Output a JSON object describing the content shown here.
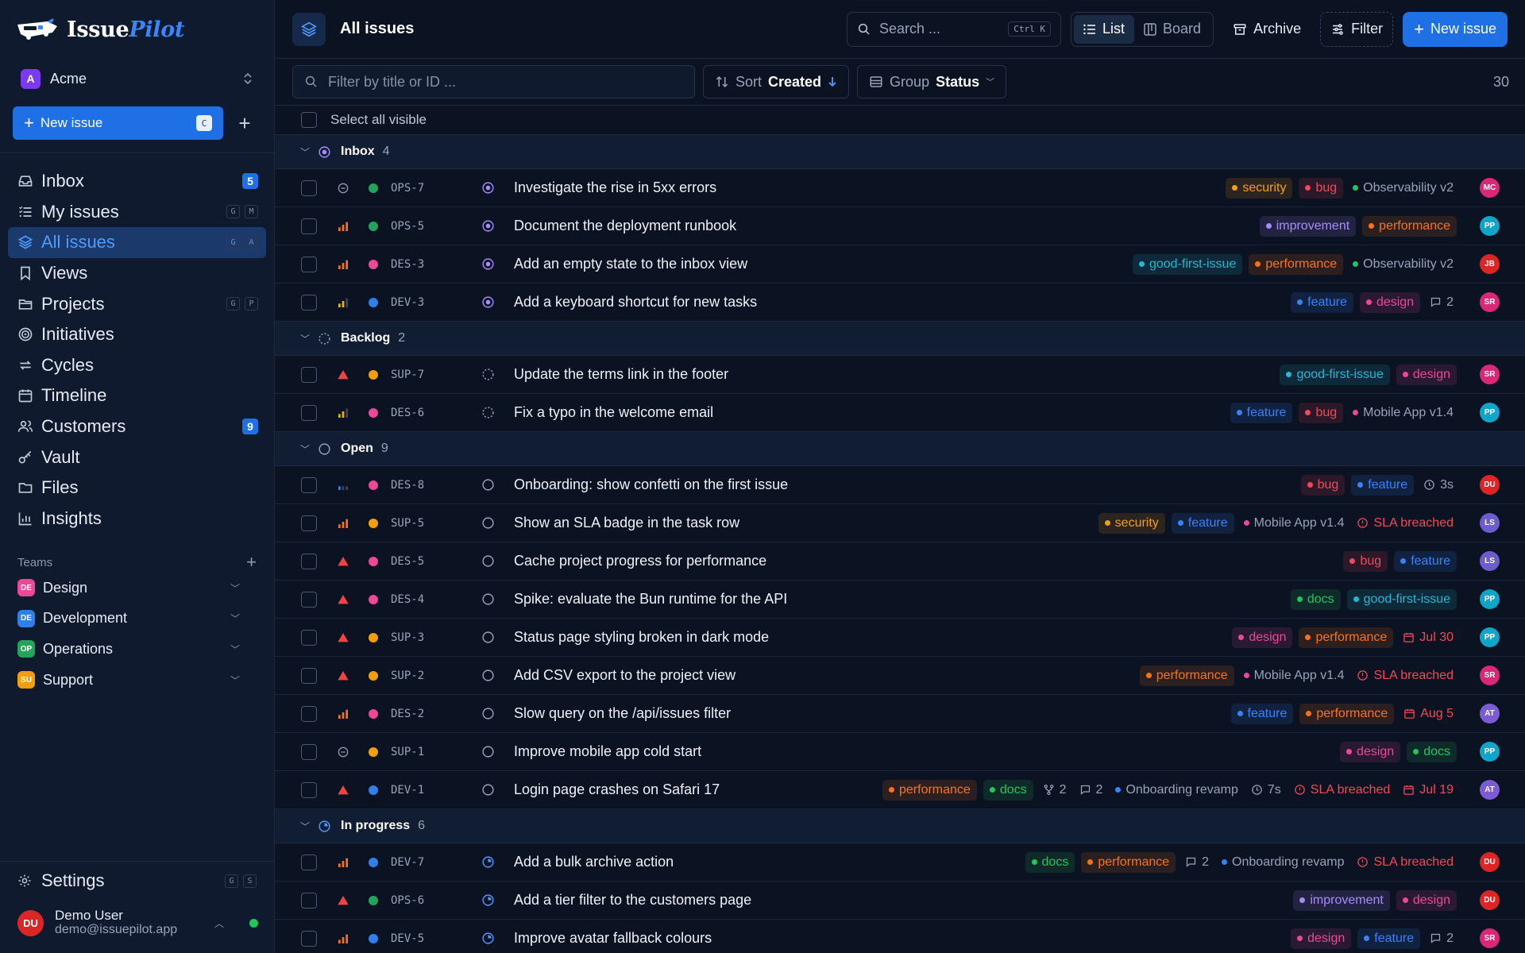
{
  "brand": {
    "name_a": "Issue",
    "name_b": "Pilot"
  },
  "workspace": {
    "initial": "A",
    "name": "Acme"
  },
  "sidebar": {
    "new_issue": {
      "label": "New issue",
      "key": "C"
    },
    "nav": [
      {
        "name": "inbox",
        "label": "Inbox",
        "icon": "inbox-icon",
        "badge": "5",
        "keys": []
      },
      {
        "name": "my-issues",
        "label": "My issues",
        "icon": "list-icon",
        "badge": "",
        "keys": [
          "G",
          "M"
        ]
      },
      {
        "name": "all-issues",
        "label": "All issues",
        "icon": "layers-icon",
        "badge": "",
        "keys": [
          "G",
          "A"
        ],
        "active": true
      },
      {
        "name": "views",
        "label": "Views",
        "icon": "bookmark-icon",
        "badge": "",
        "keys": []
      },
      {
        "name": "projects",
        "label": "Projects",
        "icon": "folder-icon",
        "badge": "",
        "keys": [
          "G",
          "P"
        ]
      },
      {
        "name": "initiatives",
        "label": "Initiatives",
        "icon": "target-icon",
        "badge": "",
        "keys": []
      },
      {
        "name": "cycles",
        "label": "Cycles",
        "icon": "cycle-icon",
        "badge": "",
        "keys": []
      },
      {
        "name": "timeline",
        "label": "Timeline",
        "icon": "calendar-icon",
        "badge": "",
        "keys": []
      },
      {
        "name": "customers",
        "label": "Customers",
        "icon": "users-icon",
        "badge": "9",
        "keys": []
      },
      {
        "name": "vault",
        "label": "Vault",
        "icon": "key-icon",
        "badge": "",
        "keys": []
      },
      {
        "name": "files",
        "label": "Files",
        "icon": "files-icon",
        "badge": "",
        "keys": []
      },
      {
        "name": "insights",
        "label": "Insights",
        "icon": "chart-icon",
        "badge": "",
        "keys": []
      }
    ],
    "teams_label": "Teams",
    "teams": [
      {
        "initials": "DE",
        "name": "Design",
        "color": "#ec4899"
      },
      {
        "initials": "DE",
        "name": "Development",
        "color": "#2f80ed"
      },
      {
        "initials": "OP",
        "name": "Operations",
        "color": "#22a559"
      },
      {
        "initials": "SU",
        "name": "Support",
        "color": "#f59e0b"
      }
    ],
    "settings": {
      "label": "Settings",
      "keys": [
        "G",
        "S"
      ]
    },
    "user": {
      "initials": "DU",
      "name": "Demo User",
      "email": "demo@issuepilot.app"
    }
  },
  "header": {
    "title": "All issues",
    "search_placeholder": "Search ...",
    "search_key": "Ctrl K",
    "view_list": "List",
    "view_board": "Board",
    "archive": "Archive",
    "filter": "Filter",
    "new_issue": "New issue"
  },
  "filters": {
    "title_placeholder": "Filter by title or ID ...",
    "sort_label": "Sort",
    "sort_value": "Created",
    "group_label": "Group",
    "group_value": "Status",
    "count": "30"
  },
  "select_all": "Select all visible",
  "colors": {
    "security": "#f59e0b",
    "bug": "#f04a58",
    "improvement": "#a78bfa",
    "performance": "#f97316",
    "good-first-issue": "#22b8cf",
    "feature": "#3b82f6",
    "design": "#ec4899",
    "docs": "#22c55e",
    "team_design": "#ec4899",
    "team_dev": "#2f80ed",
    "team_ops": "#22a559",
    "team_sup": "#f59e0b"
  },
  "groups": [
    {
      "name": "Inbox",
      "count": "4",
      "status": "inbox",
      "rows": [
        {
          "id": "OPS-7",
          "title": "Investigate the rise in 5xx errors",
          "prio": "none",
          "team": "ops",
          "meta": [
            {
              "t": "tag",
              "v": "security"
            },
            {
              "t": "tag",
              "v": "bug"
            },
            {
              "t": "proj",
              "v": "Observability v2",
              "c": "#22c55e"
            }
          ],
          "av": {
            "i": "MC",
            "c": "#db2777"
          }
        },
        {
          "id": "OPS-5",
          "title": "Document the deployment runbook",
          "prio": "high",
          "team": "ops",
          "meta": [
            {
              "t": "tag",
              "v": "improvement"
            },
            {
              "t": "tag",
              "v": "performance"
            }
          ],
          "av": {
            "i": "PP",
            "c": "#0ea5c9"
          }
        },
        {
          "id": "DES-3",
          "title": "Add an empty state to the inbox view",
          "prio": "high",
          "team": "design",
          "meta": [
            {
              "t": "tag",
              "v": "good-first-issue"
            },
            {
              "t": "tag",
              "v": "performance"
            },
            {
              "t": "proj",
              "v": "Observability v2",
              "c": "#22c55e"
            }
          ],
          "av": {
            "i": "JB",
            "c": "#dc2626"
          }
        },
        {
          "id": "DEV-3",
          "title": "Add a keyboard shortcut for new tasks",
          "prio": "medium",
          "team": "dev",
          "meta": [
            {
              "t": "tag",
              "v": "feature"
            },
            {
              "t": "tag",
              "v": "design"
            },
            {
              "t": "comments",
              "v": "2"
            }
          ],
          "av": {
            "i": "SR",
            "c": "#db2777"
          }
        }
      ]
    },
    {
      "name": "Backlog",
      "count": "2",
      "status": "backlog",
      "rows": [
        {
          "id": "SUP-7",
          "title": "Update the terms link in the footer",
          "prio": "urgent",
          "team": "sup",
          "meta": [
            {
              "t": "tag",
              "v": "good-first-issue"
            },
            {
              "t": "tag",
              "v": "design"
            }
          ],
          "av": {
            "i": "SR",
            "c": "#db2777"
          }
        },
        {
          "id": "DES-6",
          "title": "Fix a typo in the welcome email",
          "prio": "medium",
          "team": "design",
          "meta": [
            {
              "t": "tag",
              "v": "feature"
            },
            {
              "t": "tag",
              "v": "bug"
            },
            {
              "t": "proj",
              "v": "Mobile App v1.4",
              "c": "#ec4899"
            }
          ],
          "av": {
            "i": "PP",
            "c": "#0ea5c9"
          }
        }
      ]
    },
    {
      "name": "Open",
      "count": "9",
      "status": "open",
      "rows": [
        {
          "id": "DES-8",
          "title": "Onboarding: show confetti on the first issue",
          "prio": "low",
          "team": "design",
          "meta": [
            {
              "t": "tag",
              "v": "bug"
            },
            {
              "t": "tag",
              "v": "feature"
            },
            {
              "t": "time",
              "v": "3s"
            }
          ],
          "av": {
            "i": "DU",
            "c": "#dc2626"
          }
        },
        {
          "id": "SUP-5",
          "title": "Show an SLA badge in the task row",
          "prio": "high",
          "team": "sup",
          "meta": [
            {
              "t": "tag",
              "v": "security"
            },
            {
              "t": "tag",
              "v": "feature"
            },
            {
              "t": "proj",
              "v": "Mobile App v1.4",
              "c": "#ec4899"
            },
            {
              "t": "sla",
              "v": "SLA breached"
            }
          ],
          "av": {
            "i": "LS",
            "c": "#6d5bd0"
          }
        },
        {
          "id": "DES-5",
          "title": "Cache project progress for performance",
          "prio": "urgent",
          "team": "design",
          "meta": [
            {
              "t": "tag",
              "v": "bug"
            },
            {
              "t": "tag",
              "v": "feature"
            }
          ],
          "av": {
            "i": "LS",
            "c": "#6d5bd0"
          }
        },
        {
          "id": "DES-4",
          "title": "Spike: evaluate the Bun runtime for the API",
          "prio": "urgent",
          "team": "design",
          "meta": [
            {
              "t": "tag",
              "v": "docs"
            },
            {
              "t": "tag",
              "v": "good-first-issue"
            }
          ],
          "av": {
            "i": "PP",
            "c": "#0ea5c9"
          }
        },
        {
          "id": "SUP-3",
          "title": "Status page styling broken in dark mode",
          "prio": "urgent",
          "team": "sup",
          "meta": [
            {
              "t": "tag",
              "v": "design"
            },
            {
              "t": "tag",
              "v": "performance"
            },
            {
              "t": "due",
              "v": "Jul 30"
            }
          ],
          "av": {
            "i": "PP",
            "c": "#0ea5c9"
          }
        },
        {
          "id": "SUP-2",
          "title": "Add CSV export to the project view",
          "prio": "urgent",
          "team": "sup",
          "meta": [
            {
              "t": "tag",
              "v": "performance"
            },
            {
              "t": "proj",
              "v": "Mobile App v1.4",
              "c": "#ec4899"
            },
            {
              "t": "sla",
              "v": "SLA breached"
            }
          ],
          "av": {
            "i": "SR",
            "c": "#db2777"
          }
        },
        {
          "id": "DES-2",
          "title": "Slow query on the /api/issues filter",
          "prio": "high",
          "team": "design",
          "meta": [
            {
              "t": "tag",
              "v": "feature"
            },
            {
              "t": "tag",
              "v": "performance"
            },
            {
              "t": "due",
              "v": "Aug 5"
            }
          ],
          "av": {
            "i": "AT",
            "c": "#7c5cd6"
          }
        },
        {
          "id": "SUP-1",
          "title": "Improve mobile app cold start",
          "prio": "none",
          "team": "sup",
          "meta": [
            {
              "t": "tag",
              "v": "design"
            },
            {
              "t": "tag",
              "v": "docs"
            }
          ],
          "av": {
            "i": "PP",
            "c": "#0ea5c9"
          }
        },
        {
          "id": "DEV-1",
          "title": "Login page crashes on Safari 17",
          "prio": "urgent",
          "team": "dev",
          "meta": [
            {
              "t": "tag",
              "v": "performance"
            },
            {
              "t": "tag",
              "v": "docs"
            },
            {
              "t": "subs",
              "v": "2"
            },
            {
              "t": "comments",
              "v": "2"
            },
            {
              "t": "proj",
              "v": "Onboarding revamp",
              "c": "#3b82f6"
            },
            {
              "t": "time",
              "v": "7s"
            },
            {
              "t": "sla",
              "v": "SLA breached"
            },
            {
              "t": "due",
              "v": "Jul 19"
            }
          ],
          "av": {
            "i": "AT",
            "c": "#7c5cd6"
          }
        }
      ]
    },
    {
      "name": "In progress",
      "count": "6",
      "status": "progress",
      "rows": [
        {
          "id": "DEV-7",
          "title": "Add a bulk archive action",
          "prio": "high",
          "team": "dev",
          "meta": [
            {
              "t": "tag",
              "v": "docs"
            },
            {
              "t": "tag",
              "v": "performance"
            },
            {
              "t": "comments",
              "v": "2"
            },
            {
              "t": "proj",
              "v": "Onboarding revamp",
              "c": "#3b82f6"
            },
            {
              "t": "sla",
              "v": "SLA breached"
            }
          ],
          "av": {
            "i": "DU",
            "c": "#dc2626"
          }
        },
        {
          "id": "OPS-6",
          "title": "Add a tier filter to the customers page",
          "prio": "urgent",
          "team": "ops",
          "meta": [
            {
              "t": "tag",
              "v": "improvement"
            },
            {
              "t": "tag",
              "v": "design"
            }
          ],
          "av": {
            "i": "DU",
            "c": "#dc2626"
          }
        },
        {
          "id": "DEV-5",
          "title": "Improve avatar fallback colours",
          "prio": "high",
          "team": "dev",
          "meta": [
            {
              "t": "tag",
              "v": "design"
            },
            {
              "t": "tag",
              "v": "feature"
            },
            {
              "t": "comments",
              "v": "2"
            }
          ],
          "av": {
            "i": "SR",
            "c": "#db2777"
          }
        }
      ]
    }
  ]
}
